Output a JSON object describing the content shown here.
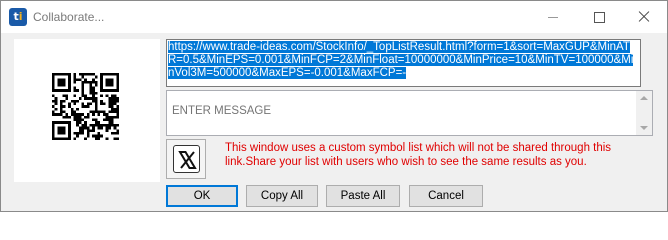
{
  "window": {
    "title": "Collaborate...",
    "app_icon_letters": "ti"
  },
  "titlebar_buttons": [
    "minimize-icon",
    "maximize-icon",
    "close-icon"
  ],
  "qr": {
    "icon": "qr-code-icon"
  },
  "link": {
    "url": "https://www.trade-ideas.com/StockInfo/_TopListResult.html?form=1&sort=MaxGUP&MinATR=0.5&MinEPS=0.001&MinFCP=2&MinFloat=10000000&MinPrice=10&MinTV=100000&MinVol3M=500000&MaxEPS=-0.001&MaxFCP=-"
  },
  "message": {
    "placeholder": "ENTER MESSAGE",
    "value": ""
  },
  "share": {
    "icon": "x-logo-icon"
  },
  "warning": "This window uses a custom symbol list which will not be shared through this link.Share your list with users who wish to see the same results as you.",
  "buttons": {
    "ok": "OK",
    "copy_all": "Copy All",
    "paste_all": "Paste All",
    "cancel": "Cancel"
  },
  "colors": {
    "selection": "#0078d7",
    "warning": "#e00000",
    "app_icon": "#1a5aa8"
  }
}
